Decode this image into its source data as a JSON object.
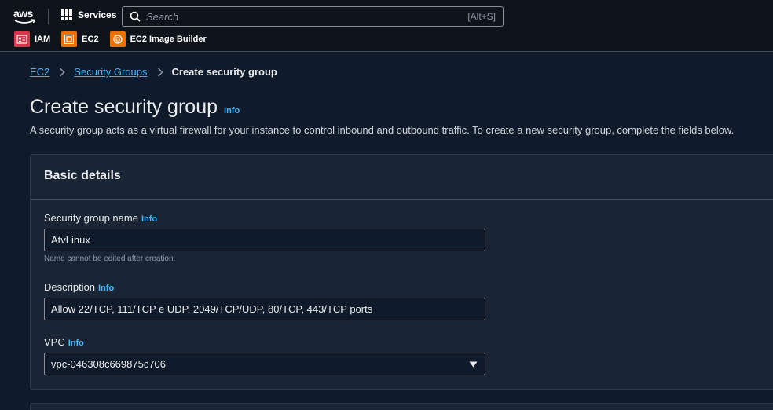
{
  "nav": {
    "logo_text": "aws",
    "services_label": "Services",
    "search_placeholder": "Search",
    "search_shortcut": "[Alt+S]",
    "favorites": [
      {
        "label": "IAM",
        "icon": "iam-icon",
        "color": "#dd344c"
      },
      {
        "label": "EC2",
        "icon": "ec2-icon",
        "color": "#ed7100"
      },
      {
        "label": "EC2 Image Builder",
        "icon": "ec2-image-builder-icon",
        "color": "#ed7100"
      }
    ]
  },
  "breadcrumb": {
    "items": [
      "EC2",
      "Security Groups"
    ],
    "current": "Create security group"
  },
  "page": {
    "title": "Create security group",
    "info_label": "Info",
    "description": "A security group acts as a virtual firewall for your instance to control inbound and outbound traffic. To create a new security group, complete the fields below."
  },
  "basic_details": {
    "header": "Basic details",
    "name_label": "Security group name",
    "name_value": "AtvLinux",
    "name_hint": "Name cannot be edited after creation.",
    "description_label": "Description",
    "description_value": "Allow 22/TCP, 111/TCP e UDP, 2049/TCP/UDP, 80/TCP, 443/TCP ports",
    "vpc_label": "VPC",
    "vpc_value": "vpc-046308c669875c706",
    "info_label": "Info"
  },
  "colors": {
    "link": "#42b4ff",
    "background": "#0f1b2a",
    "panel": "#192534",
    "nav": "#0f141a"
  }
}
